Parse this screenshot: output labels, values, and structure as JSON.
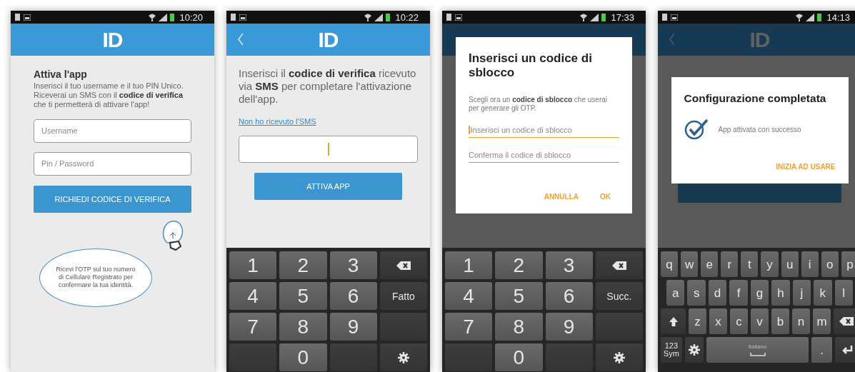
{
  "screens": [
    {
      "kind": "login",
      "status_bar": {
        "time": "10:20"
      },
      "header": {
        "logo": "ID",
        "back_button": false
      },
      "title": "Attiva l'app",
      "intro": "Inserisci il tuo username e il tuo PIN Unico. Riceverai un SMS con il **codice di verifica** che ti permetterà di attivare l'app!",
      "fields": [
        {
          "placeholder": "Username"
        },
        {
          "placeholder": "Pin / Password"
        }
      ],
      "button": "RICHIEDI CODICE DI VERIFICA",
      "tip": "Ricevi l'OTP sul tuo numero di Cellulare Registrato per confermare la tua identità."
    },
    {
      "kind": "verify",
      "status_bar": {
        "time": "10:22"
      },
      "header": {
        "logo": "ID",
        "back_button": true
      },
      "intro": "Inserisci il **codice di verifica** ricevuto via **SMS** per completare l'attivazione dell'app.",
      "link": "Non ho ricevuto l'SMS",
      "code_field": {
        "focused": true
      },
      "button": "ATTIVA APP",
      "keyboard": {
        "kind": "numeric",
        "rows": [
          [
            {
              "kind": "char",
              "label": "1"
            },
            {
              "kind": "char",
              "label": "2"
            },
            {
              "kind": "char",
              "label": "3"
            },
            {
              "kind": "backspace"
            }
          ],
          [
            {
              "kind": "char",
              "label": "4"
            },
            {
              "kind": "char",
              "label": "5"
            },
            {
              "kind": "char",
              "label": "6"
            },
            {
              "kind": "action",
              "label": "Fatto"
            }
          ],
          [
            {
              "kind": "char",
              "label": "7"
            },
            {
              "kind": "char",
              "label": "8"
            },
            {
              "kind": "char",
              "label": "9"
            },
            {
              "kind": "blank"
            }
          ],
          [
            {
              "kind": "blank"
            },
            {
              "kind": "char",
              "label": "0"
            },
            {
              "kind": "blank"
            },
            {
              "kind": "settings"
            }
          ]
        ]
      }
    },
    {
      "kind": "dialog",
      "status_bar": {
        "time": "17:33"
      },
      "header": {
        "back_button": false
      },
      "dialog": {
        "kind": "form",
        "title": "Inserisci un codice di sblocco",
        "text": "Scegli ora un **codice di sblocco** che userai per generare gli OTP.",
        "fields": [
          {
            "placeholder": "Inserisci un codice di sblocco",
            "focused": true
          },
          {
            "placeholder": "Conferma il codice di sblocco",
            "focused": false
          }
        ],
        "buttons": [
          "ANNULLA",
          "OK"
        ]
      },
      "keyboard": {
        "kind": "numeric",
        "rows": [
          [
            {
              "kind": "char",
              "label": "1"
            },
            {
              "kind": "char",
              "label": "2"
            },
            {
              "kind": "char",
              "label": "3"
            },
            {
              "kind": "backspace"
            }
          ],
          [
            {
              "kind": "char",
              "label": "4"
            },
            {
              "kind": "char",
              "label": "5"
            },
            {
              "kind": "char",
              "label": "6"
            },
            {
              "kind": "action",
              "label": "Succ."
            }
          ],
          [
            {
              "kind": "char",
              "label": "7"
            },
            {
              "kind": "char",
              "label": "8"
            },
            {
              "kind": "char",
              "label": "9"
            },
            {
              "kind": "blank"
            }
          ],
          [
            {
              "kind": "blank"
            },
            {
              "kind": "char",
              "label": "0"
            },
            {
              "kind": "blank"
            },
            {
              "kind": "settings"
            }
          ]
        ]
      }
    },
    {
      "kind": "dialog",
      "status_bar": {
        "time": "14:13"
      },
      "header": {
        "logo": "ID",
        "back_button": true
      },
      "dialog": {
        "kind": "message",
        "title": "Configurazione completata",
        "text": "App attivata con successo",
        "buttons": [
          "INIZIA AD USARE"
        ]
      },
      "keyboard": {
        "kind": "qwerty",
        "rows": [
          [
            {
              "kind": "char",
              "label": "q"
            },
            {
              "kind": "char",
              "label": "w"
            },
            {
              "kind": "char",
              "label": "e"
            },
            {
              "kind": "char",
              "label": "r"
            },
            {
              "kind": "char",
              "label": "t"
            },
            {
              "kind": "char",
              "label": "y"
            },
            {
              "kind": "char",
              "label": "u"
            },
            {
              "kind": "char",
              "label": "i"
            },
            {
              "kind": "char",
              "label": "o"
            },
            {
              "kind": "char",
              "label": "p"
            }
          ],
          [
            {
              "kind": "char",
              "label": "a"
            },
            {
              "kind": "char",
              "label": "s"
            },
            {
              "kind": "char",
              "label": "d"
            },
            {
              "kind": "char",
              "label": "f"
            },
            {
              "kind": "char",
              "label": "g"
            },
            {
              "kind": "char",
              "label": "h"
            },
            {
              "kind": "char",
              "label": "j"
            },
            {
              "kind": "char",
              "label": "k"
            },
            {
              "kind": "char",
              "label": "l"
            }
          ],
          [
            {
              "kind": "shift"
            },
            {
              "kind": "char",
              "label": "z"
            },
            {
              "kind": "char",
              "label": "x"
            },
            {
              "kind": "char",
              "label": "c"
            },
            {
              "kind": "char",
              "label": "v"
            },
            {
              "kind": "char",
              "label": "b"
            },
            {
              "kind": "char",
              "label": "n"
            },
            {
              "kind": "char",
              "label": "m"
            },
            {
              "kind": "backspace"
            }
          ]
        ],
        "bottom_bar": {
          "symbols_key": {
            "label": "123",
            "sublabel": "Sym"
          },
          "space_key": {
            "label": "Italiano"
          },
          "period_key": {
            "label": "."
          }
        }
      }
    }
  ]
}
